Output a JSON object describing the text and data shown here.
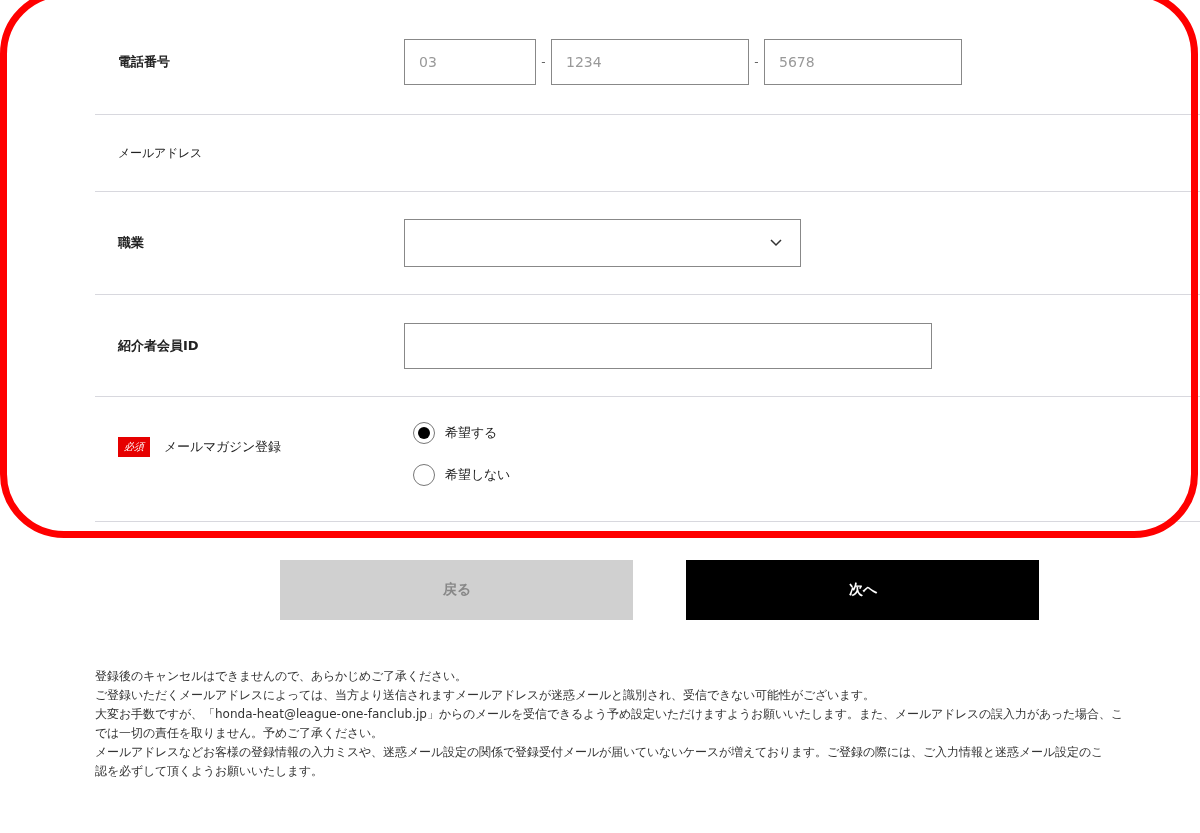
{
  "form": {
    "rows": [
      {
        "kind": "phone",
        "label": "電話番号",
        "required": false,
        "fields": [
          {
            "placeholder": "03"
          },
          {
            "placeholder": "1234"
          },
          {
            "placeholder": "5678"
          }
        ],
        "separator": "-"
      },
      {
        "kind": "empty",
        "label": "メールアドレス",
        "required": false
      },
      {
        "kind": "select",
        "label": "職業",
        "required": false
      },
      {
        "kind": "text",
        "label": "紹介者会員ID",
        "required": false
      },
      {
        "kind": "radio",
        "label": "メールマガジン登録",
        "required": true,
        "required_badge": "必須",
        "options": [
          {
            "label": "希望する",
            "selected": true
          },
          {
            "label": "希望しない",
            "selected": false
          }
        ]
      }
    ]
  },
  "buttons": [
    {
      "kind": "back",
      "label": "戻る"
    },
    {
      "kind": "next",
      "label": "次へ"
    }
  ],
  "notes": [
    "登録後のキャンセルはできませんので、あらかじめご了承ください。",
    "ご登録いただくメールアドレスによっては、当方より送信されますメールアドレスが迷惑メールと識別され、受信できない可能性がございます。",
    "大変お手数ですが、「honda-heat@league-one-fanclub.jp」からのメールを受信できるよう予め設定いただけますようお願いいたします。また、メールアドレスの誤入力があった場合、こ",
    "では一切の責任を取りません。予めご了承ください。",
    "メールアドレスなどお客様の登録情報の入力ミスや、迷惑メール設定の関係で登録受付メールが届いていないケースが増えております。ご登録の際には、ご入力情報と迷惑メール設定のこ",
    "認を必ずして頂くようお願いいたします。"
  ]
}
